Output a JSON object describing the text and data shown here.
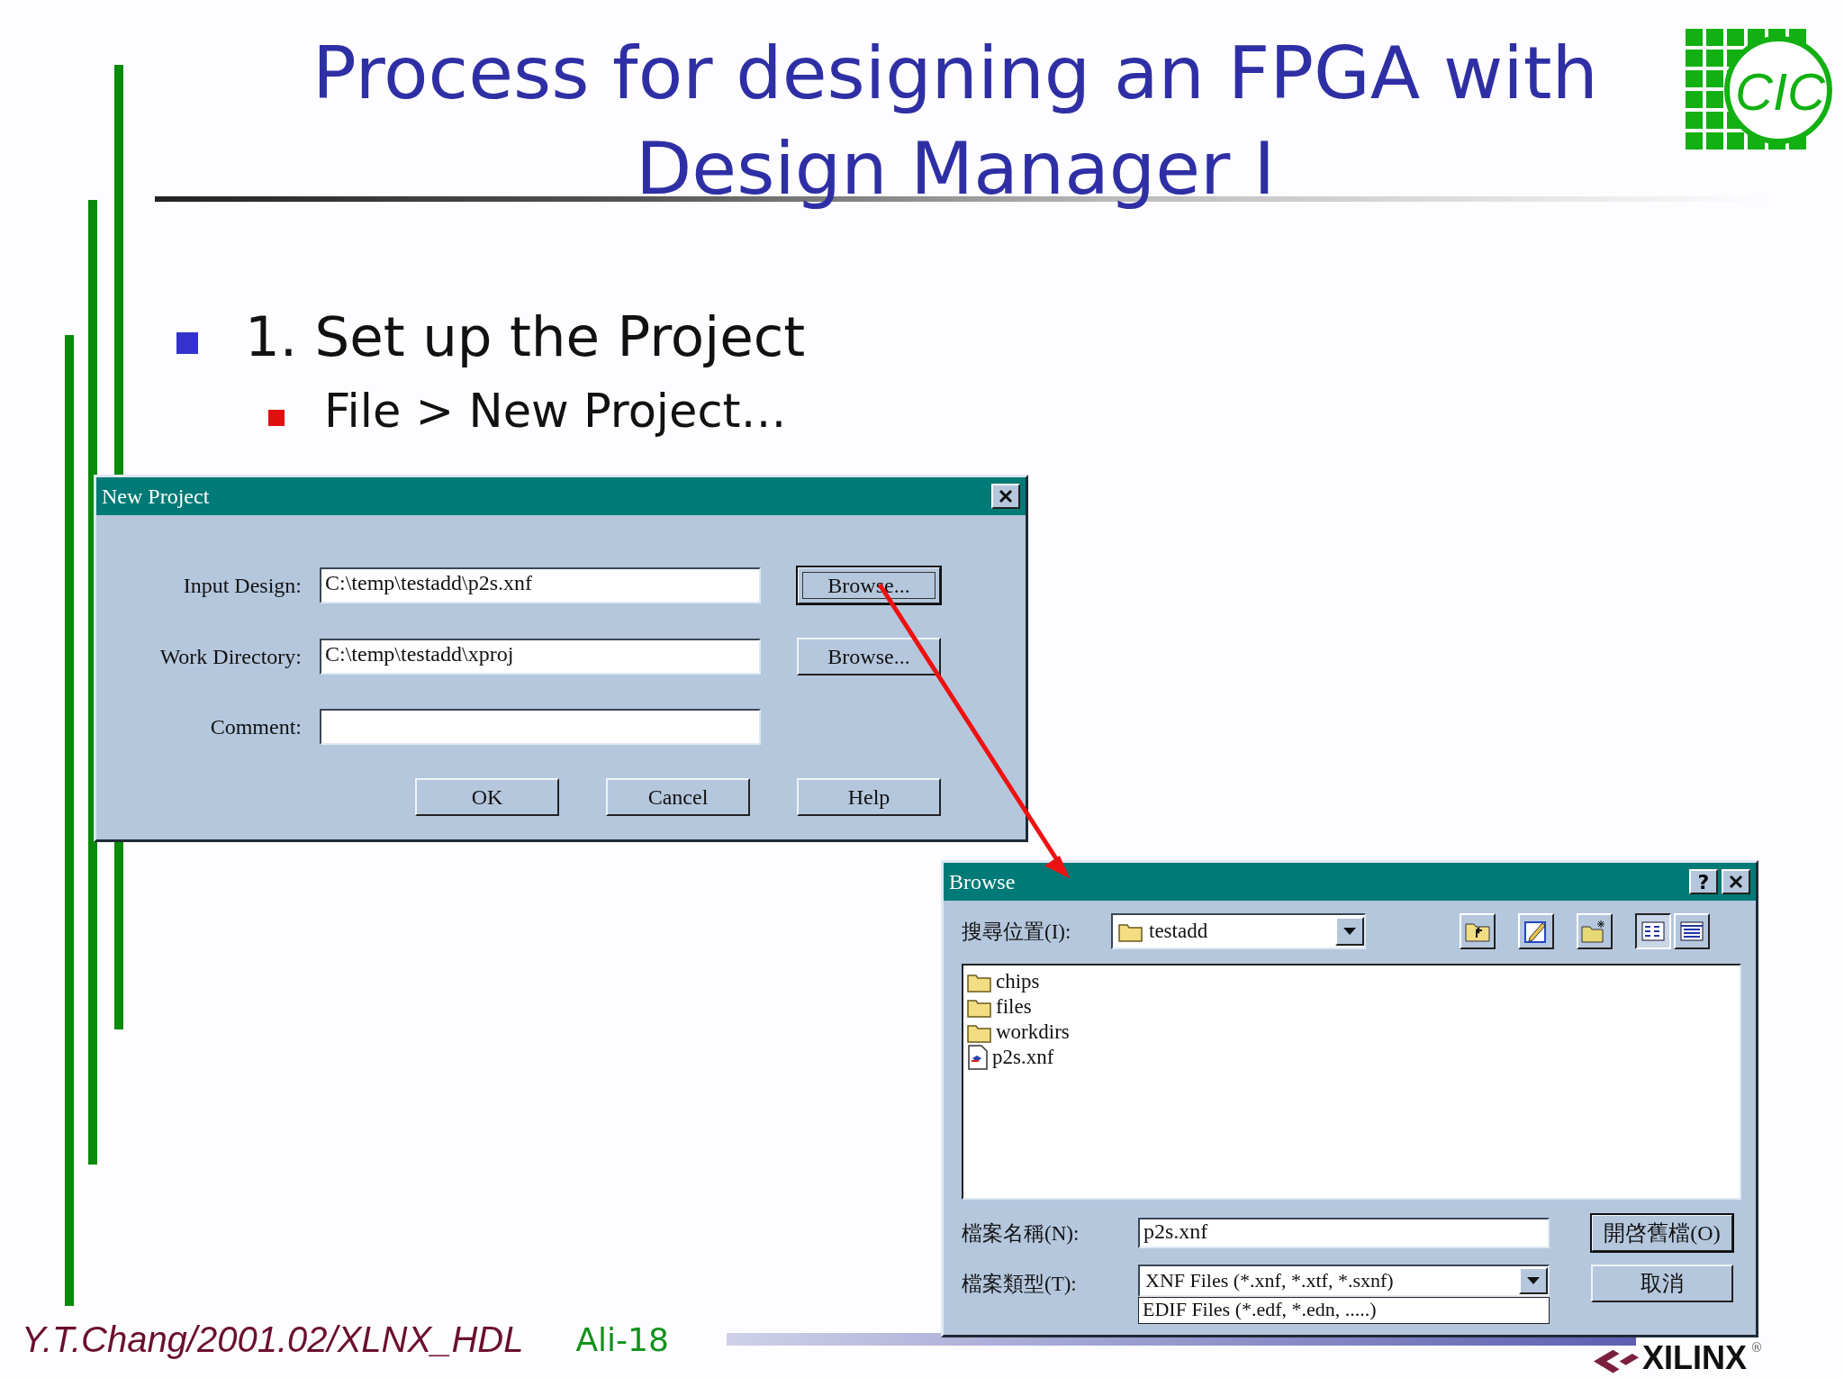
{
  "title": {
    "lines": [
      "Process for designing an FPGA with",
      "Design Manager  I"
    ]
  },
  "logo": {
    "text": "CIC"
  },
  "bullets": [
    {
      "text": "1. Set up the Project",
      "children": [
        {
          "text": "File > New Project…"
        }
      ]
    }
  ],
  "new_project_dialog": {
    "title": "New Project",
    "fields": [
      {
        "label": "Input Design:",
        "value": "C:\\temp\\testadd\\p2s.xnf",
        "browse": {
          "label": "Browse...",
          "focused": true
        }
      },
      {
        "label": "Work Directory:",
        "value": "C:\\temp\\testadd\\xproj",
        "browse": {
          "label": "Browse...",
          "focused": false
        }
      },
      {
        "label": "Comment:"
      }
    ],
    "buttons": [
      "OK",
      "Cancel",
      "Help"
    ]
  },
  "browse_dialog": {
    "title": "Browse",
    "help": "?",
    "look_in": {
      "label": "搜尋位置(I):",
      "value": "testadd"
    },
    "toolbar": [
      {
        "kind": "up"
      },
      {
        "kind": "desktop"
      },
      {
        "kind": "newfolder"
      },
      {
        "kind": "list",
        "selected": true
      },
      {
        "kind": "details",
        "selected": false
      }
    ],
    "files": [
      {
        "name": "chips",
        "kind": "folder"
      },
      {
        "name": "files",
        "kind": "folder"
      },
      {
        "name": "workdirs",
        "kind": "folder"
      },
      {
        "name": "p2s.xnf",
        "kind": "file"
      }
    ],
    "file_name": {
      "label": "檔案名稱(N):",
      "value": "p2s.xnf"
    },
    "file_type": {
      "label": "檔案類型(T):",
      "value": "XNF Files (*.xnf, *.xtf, *.sxnf)",
      "options": [
        "EDIF Files (*.edf, *.edn, .....)"
      ]
    },
    "buttons": [
      {
        "label": "開啓舊檔(O)",
        "default": true
      },
      {
        "label": "取消",
        "default": false
      }
    ]
  },
  "footer": {
    "author": "Y.T.Chang/2001.02/XLNX_HDL",
    "page": "Ali-18",
    "brand": "XILINX",
    "brand_mark": "®"
  }
}
